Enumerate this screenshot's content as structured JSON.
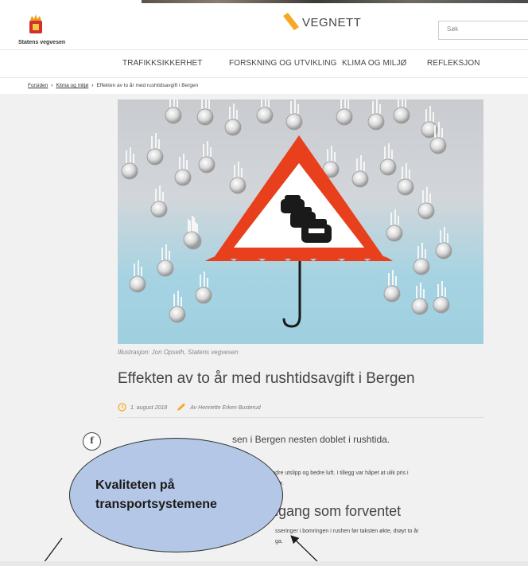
{
  "header": {
    "logo_text": "Statens vegvesen",
    "brand": "VEGNETT",
    "search_placeholder": "Søk"
  },
  "nav": {
    "items": [
      "TRAFIKKSIKKERHET",
      "FORSKNING OG UTVIKLING",
      "KLIMA OG MILJØ",
      "REFLEKSJON"
    ]
  },
  "breadcrumb": {
    "items": [
      "Forsiden",
      "Klima og miljø",
      "Effekten av to år med rushtidsavgift i Bergen"
    ]
  },
  "hero": {
    "caption": "Illustrasjon: Jon Opseth, Statens vegvesen"
  },
  "article": {
    "title": "Effekten av to år med rushtidsavgift i Bergen",
    "date": "1. august 2018",
    "author": "Av Henriette Erken Busterud",
    "lead_visible": "sen i Bergen nesten doblet i rushtida.",
    "body_line1": "mindre utslipp og bedre luft. I tillegg var håpet at ulik pris i",
    "body_line2": "dre kø.",
    "heading_visible": "dgang som forventet",
    "body2_line1": "sseringer i bomringen i rushen før taksten økte, drøyt to år",
    "body2_line2": "ga."
  },
  "share": {
    "facebook_glyph": "f"
  },
  "annotation": {
    "line1": "Kvaliteten på",
    "line2": "transportsystemene",
    "fill_color": "#b4c7e7"
  },
  "colors": {
    "accent_orange": "#f7a823",
    "sign_red": "#e8401c",
    "logo_red": "#d32f2f"
  }
}
